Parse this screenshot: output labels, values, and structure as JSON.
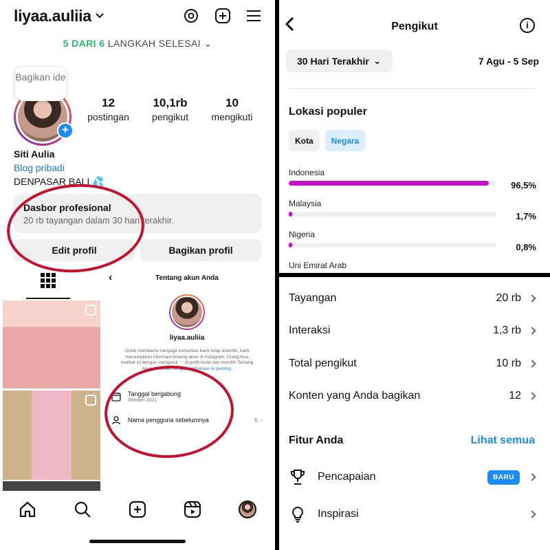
{
  "profile": {
    "username": "liyaa.auliia",
    "steps_done": "5 DARI 6",
    "steps_rest": "LANGKAH SELESAI",
    "bubble": "Bagikan ide",
    "stats": [
      {
        "n": "12",
        "l": "postingan"
      },
      {
        "n": "10,1rb",
        "l": "pengikut"
      },
      {
        "n": "10",
        "l": "mengikuti"
      }
    ],
    "name": "Siti Aulia",
    "category": "Blog pribadi",
    "location": "DENPASAR BALI 💦",
    "dashboard_title": "Dasbor profesional",
    "dashboard_sub": "20 rb tayangan dalam 30 hari terakhir.",
    "edit_btn": "Edit profil",
    "share_btn": "Bagikan profil"
  },
  "about": {
    "title": "Tentang akun Anda",
    "username": "liyaa.auliia",
    "desc": "Untuk membantu menjaga komunitas kami tetap autentik, kami menampilkan informasi tentang akun di Instagram. Orang bisa melihat ini dengan mengetuk ⋯ di profil Anda dan memilih Tentang Akun Ini.",
    "link": "Lihat mengapa informasi ini penting.",
    "joined_label": "Tanggal bergabung",
    "joined_value": "Oktober 2021",
    "prev_names_label": "Nama pengguna sebelumnya",
    "prev_names_count": "5"
  },
  "followers": {
    "title": "Pengikut",
    "period": "30 Hari Terakhir",
    "range": "7 Agu - 5 Sep",
    "section": "Lokasi populer",
    "chips": [
      "Kota",
      "Negara"
    ],
    "countries": [
      {
        "name": "Indonesia",
        "pct": "96,5%",
        "value": 96.5
      },
      {
        "name": "Malaysia",
        "pct": "1,7%",
        "value": 1.7
      },
      {
        "name": "Nigeria",
        "pct": "0,8%",
        "value": 0.8
      },
      {
        "name": "Uni Emirat Arab",
        "pct": "",
        "value": 0
      }
    ]
  },
  "insights": {
    "rows": [
      {
        "label": "Tayangan",
        "value": "20 rb"
      },
      {
        "label": "Interaksi",
        "value": "1,3 rb"
      },
      {
        "label": "Total pengikut",
        "value": "10 rb"
      },
      {
        "label": "Konten yang Anda bagikan",
        "value": "12"
      }
    ],
    "features_title": "Fitur Anda",
    "see_all": "Lihat semua",
    "features": [
      {
        "label": "Pencapaian",
        "badge": "BARU",
        "icon": "trophy-icon"
      },
      {
        "label": "Inspirasi",
        "badge": "",
        "icon": "lightbulb-icon"
      }
    ]
  },
  "colors": {
    "accent": "#1a8cf5",
    "bar": "#c711c8",
    "annotation": "#c8102e",
    "steps_green": "#2eb872"
  }
}
